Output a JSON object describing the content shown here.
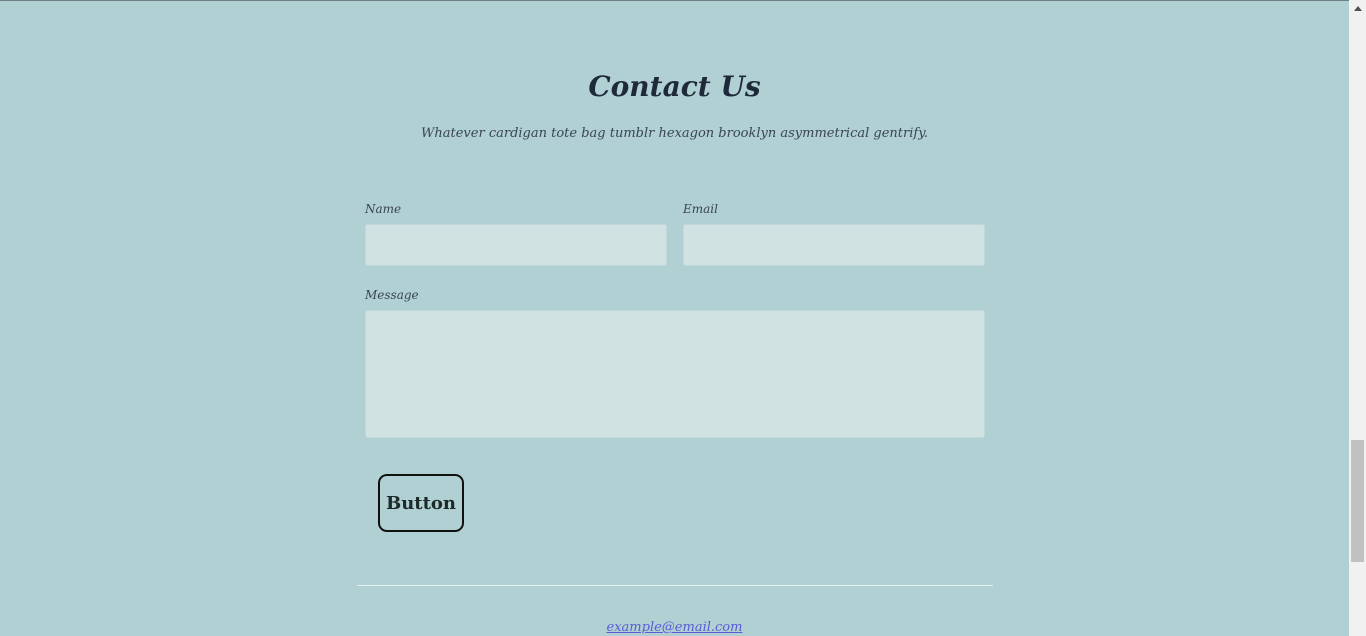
{
  "contact": {
    "title": "Contact Us",
    "subtitle": "Whatever cardigan tote bag tumblr hexagon brooklyn asymmetrical gentrify."
  },
  "form": {
    "name_label": "Name",
    "name_value": "",
    "email_label": "Email",
    "email_value": "",
    "message_label": "Message",
    "message_value": "",
    "submit_label": "Button"
  },
  "footer": {
    "email": "example@email.com"
  },
  "colors": {
    "background": "#b1d0d3",
    "field_background": "#d1e2e3",
    "link": "#5b5bd6"
  }
}
